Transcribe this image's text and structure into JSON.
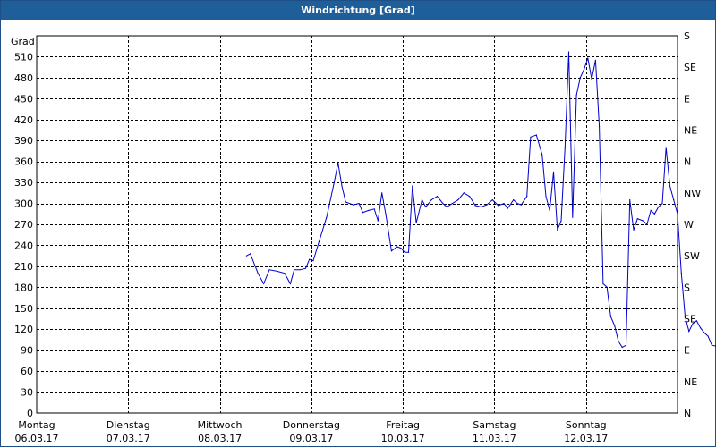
{
  "window": {
    "title": "Windrichtung [Grad]"
  },
  "chart_data": {
    "type": "line",
    "title": "Windrichtung [Grad]",
    "ylabel": "Grad",
    "ylim": [
      0,
      540
    ],
    "grid": true,
    "yticks": [
      0,
      30,
      60,
      90,
      120,
      150,
      180,
      210,
      240,
      270,
      300,
      330,
      360,
      390,
      420,
      450,
      480,
      510
    ],
    "xlim": [
      "06.03.17",
      "13.03.17"
    ],
    "x_ticks": [
      {
        "day": "Montag",
        "date": "06.03.17"
      },
      {
        "day": "Dienstag",
        "date": "07.03.17"
      },
      {
        "day": "Mittwoch",
        "date": "08.03.17"
      },
      {
        "day": "Donnerstag",
        "date": "09.03.17"
      },
      {
        "day": "Freitag",
        "date": "10.03.17"
      },
      {
        "day": "Samstag",
        "date": "11.03.17"
      },
      {
        "day": "Sonntag",
        "date": "12.03.17"
      }
    ],
    "right_axis_labels": [
      "N",
      "NE",
      "E",
      "SE",
      "S",
      "SW",
      "W",
      "NW",
      "N",
      "NE",
      "E",
      "SE",
      "S"
    ],
    "series": [
      {
        "color": "#0000cc",
        "points": [
          [
            "08.03.17 07:00",
            225
          ],
          [
            "08.03.17 08:00",
            228
          ],
          [
            "08.03.17 10:00",
            200
          ],
          [
            "08.03.17 11:30",
            185
          ],
          [
            "08.03.17 13:00",
            205
          ],
          [
            "08.03.17 15:00",
            203
          ],
          [
            "08.03.17 17:00",
            200
          ],
          [
            "08.03.17 18:30",
            185
          ],
          [
            "08.03.17 19:30",
            205
          ],
          [
            "08.03.17 21:00",
            205
          ],
          [
            "08.03.17 22:30",
            207
          ],
          [
            "08.03.17 23:30",
            220
          ],
          [
            "09.03.17 00:30",
            218
          ],
          [
            "09.03.17 02:00",
            245
          ],
          [
            "09.03.17 04:00",
            280
          ],
          [
            "09.03.17 06:00",
            330
          ],
          [
            "09.03.17 07:00",
            358
          ],
          [
            "09.03.17 08:00",
            325
          ],
          [
            "09.03.17 09:00",
            302
          ],
          [
            "09.03.17 11:00",
            298
          ],
          [
            "09.03.17 12:30",
            300
          ],
          [
            "09.03.17 13:30",
            287
          ],
          [
            "09.03.17 15:00",
            290
          ],
          [
            "09.03.17 16:30",
            292
          ],
          [
            "09.03.17 17:30",
            275
          ],
          [
            "09.03.17 18:30",
            315
          ],
          [
            "09.03.17 19:30",
            285
          ],
          [
            "09.03.17 21:00",
            232
          ],
          [
            "09.03.17 22:30",
            238
          ],
          [
            "09.03.17 23:30",
            236
          ],
          [
            "10.03.17 00:30",
            230
          ],
          [
            "10.03.17 01:30",
            230
          ],
          [
            "10.03.17 02:30",
            325
          ],
          [
            "10.03.17 03:30",
            272
          ],
          [
            "10.03.17 05:00",
            305
          ],
          [
            "10.03.17 06:00",
            295
          ],
          [
            "10.03.17 07:30",
            305
          ],
          [
            "10.03.17 09:00",
            310
          ],
          [
            "10.03.17 10:30",
            300
          ],
          [
            "10.03.17 11:30",
            295
          ],
          [
            "10.03.17 13:00",
            300
          ],
          [
            "10.03.17 14:30",
            305
          ],
          [
            "10.03.17 16:00",
            315
          ],
          [
            "10.03.17 17:30",
            310
          ],
          [
            "10.03.17 19:00",
            297
          ],
          [
            "10.03.17 20:30",
            295
          ],
          [
            "10.03.17 22:00",
            298
          ],
          [
            "10.03.17 23:30",
            305
          ],
          [
            "11.03.17 01:00",
            297
          ],
          [
            "11.03.17 02:30",
            300
          ],
          [
            "11.03.17 03:30",
            293
          ],
          [
            "11.03.17 05:00",
            305
          ],
          [
            "11.03.17 06:00",
            300
          ],
          [
            "11.03.17 07:00",
            298
          ],
          [
            "11.03.17 08:30",
            310
          ],
          [
            "11.03.17 09:30",
            395
          ],
          [
            "11.03.17 11:00",
            398
          ],
          [
            "11.03.17 12:30",
            370
          ],
          [
            "11.03.17 13:30",
            310
          ],
          [
            "11.03.17 14:30",
            290
          ],
          [
            "11.03.17 15:30",
            345
          ],
          [
            "11.03.17 16:30",
            262
          ],
          [
            "11.03.17 17:30",
            275
          ],
          [
            "11.03.17 18:30",
            380
          ],
          [
            "11.03.17 19:30",
            517
          ],
          [
            "11.03.17 20:30",
            280
          ],
          [
            "11.03.17 21:30",
            455
          ],
          [
            "11.03.17 22:30",
            480
          ],
          [
            "11.03.17 23:30",
            492
          ],
          [
            "12.03.17 00:30",
            508
          ],
          [
            "12.03.17 01:30",
            478
          ],
          [
            "12.03.17 02:30",
            505
          ],
          [
            "12.03.17 03:30",
            410
          ],
          [
            "12.03.17 04:30",
            185
          ],
          [
            "12.03.17 05:30",
            180
          ],
          [
            "12.03.17 06:30",
            138
          ],
          [
            "12.03.17 07:30",
            125
          ],
          [
            "12.03.17 08:30",
            103
          ],
          [
            "12.03.17 09:30",
            94
          ],
          [
            "12.03.17 10:30",
            97
          ],
          [
            "12.03.17 11:30",
            305
          ],
          [
            "12.03.17 12:30",
            262
          ],
          [
            "12.03.17 13:30",
            278
          ],
          [
            "12.03.17 15:00",
            275
          ],
          [
            "12.03.17 16:00",
            270
          ],
          [
            "12.03.17 17:00",
            290
          ],
          [
            "12.03.17 18:00",
            285
          ],
          [
            "12.03.17 19:00",
            295
          ],
          [
            "12.03.17 20:00",
            300
          ],
          [
            "12.03.17 21:00",
            380
          ],
          [
            "12.03.17 22:00",
            325
          ],
          [
            "12.03.17 23:00",
            305
          ],
          [
            "13.03.17 00:00",
            285
          ],
          [
            "13.03.17 01:00",
            200
          ],
          [
            "13.03.17 02:00",
            138
          ],
          [
            "13.03.17 03:00",
            117
          ],
          [
            "13.03.17 04:00",
            128
          ],
          [
            "13.03.17 05:00",
            132
          ],
          [
            "13.03.17 06:00",
            122
          ],
          [
            "13.03.17 07:00",
            115
          ],
          [
            "13.03.17 08:00",
            110
          ],
          [
            "13.03.17 09:00",
            97
          ],
          [
            "13.03.17 10:00",
            96
          ],
          [
            "13.03.17 11:00",
            93
          ],
          [
            "13.03.17 12:00",
            92
          ],
          [
            "13.03.17 13:00",
            158
          ],
          [
            "13.03.17 14:00",
            113
          ],
          [
            "13.03.17 15:00",
            113
          ],
          [
            "13.03.17 16:00",
            150
          ],
          [
            "13.03.17 17:00",
            205
          ],
          [
            "13.03.17 18:00",
            253
          ]
        ]
      }
    ]
  }
}
